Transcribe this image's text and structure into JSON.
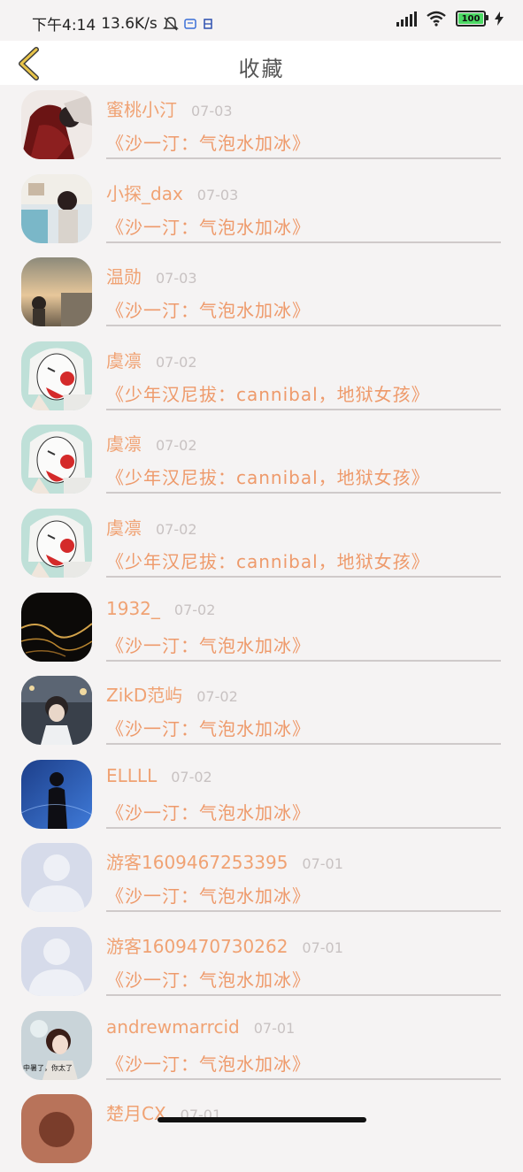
{
  "status_bar": {
    "time_net": "下午4:14",
    "speed": "13.6K/s",
    "battery": "100"
  },
  "header": {
    "title": "收藏"
  },
  "favorites": [
    {
      "name": "蜜桃小汀",
      "date": "07-03",
      "work": "《沙一汀：气泡水加冰》",
      "avatar": "avatar-photo-dark-red"
    },
    {
      "name": "小探_dax",
      "date": "07-03",
      "work": "《沙一汀：气泡水加冰》",
      "avatar": "avatar-photo-girl-room"
    },
    {
      "name": "温勋",
      "date": "07-03",
      "work": "《沙一汀：气泡水加冰》",
      "avatar": "avatar-photo-sunset"
    },
    {
      "name": "虞凛",
      "date": "07-02",
      "work": "《少年汉尼拔：cannibal，地狱女孩》",
      "avatar": "avatar-anime-clown"
    },
    {
      "name": "虞凛",
      "date": "07-02",
      "work": "《少年汉尼拔：cannibal，地狱女孩》",
      "avatar": "avatar-anime-clown"
    },
    {
      "name": "虞凛",
      "date": "07-02",
      "work": "《少年汉尼拔：cannibal，地狱女孩》",
      "avatar": "avatar-anime-clown"
    },
    {
      "name": "1932_",
      "date": "07-02",
      "work": "《沙一汀：气泡水加冰》",
      "avatar": "avatar-photo-night-shore"
    },
    {
      "name": "ZikD范屿",
      "date": "07-02",
      "work": "《沙一汀：气泡水加冰》",
      "avatar": "avatar-photo-street"
    },
    {
      "name": "ELLLL",
      "date": "07-02",
      "work": "《沙一汀：气泡水加冰》",
      "avatar": "avatar-photo-blue-silhouette"
    },
    {
      "name": "游客1609467253395",
      "date": "07-01",
      "work": "《沙一汀：气泡水加冰》",
      "avatar": "avatar-default-person"
    },
    {
      "name": "游客1609470730262",
      "date": "07-01",
      "work": "《沙一汀：气泡水加冰》",
      "avatar": "avatar-default-person"
    },
    {
      "name": "andrewmarrcid",
      "date": "07-01",
      "work": "《沙一汀：气泡水加冰》",
      "avatar": "avatar-photo-girl-caption",
      "avatar_caption": "中暑了，你太了"
    },
    {
      "name": "楚月CX",
      "date": "07-01",
      "work": "",
      "avatar": "avatar-photo-warm"
    }
  ]
}
